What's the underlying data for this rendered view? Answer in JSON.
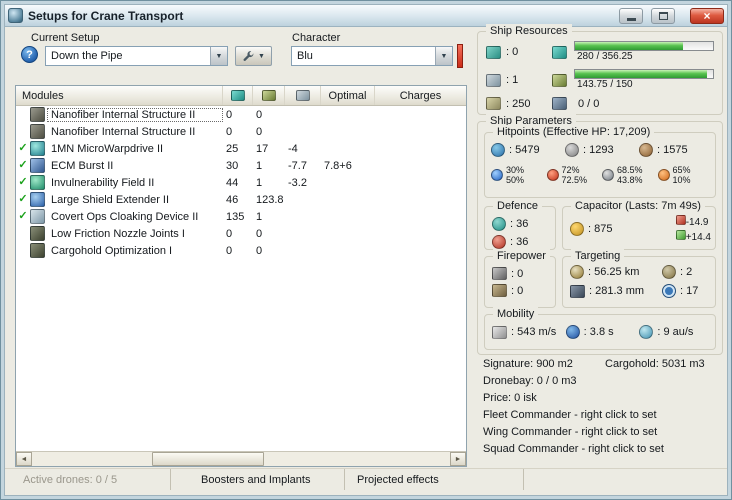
{
  "window": {
    "title": "Setups for Crane Transport"
  },
  "icons": {
    "help": "?",
    "chevron_down": "▼",
    "scroll_left": "◄",
    "scroll_right": "►",
    "close": "×"
  },
  "toolbar": {
    "current_setup_label": "Current Setup",
    "current_setup_value": "Down the Pipe",
    "character_label": "Character",
    "character_value": "Blu"
  },
  "modules": {
    "header": {
      "title": "Modules",
      "optimal": "Optimal",
      "charges": "Charges"
    },
    "rows": [
      {
        "check": "",
        "name": "Nanofiber Internal Structure II",
        "cpu": "0",
        "pg": "0",
        "cap": "",
        "optimal": "",
        "charges": ""
      },
      {
        "check": "",
        "name": "Nanofiber Internal Structure II",
        "cpu": "0",
        "pg": "0",
        "cap": "",
        "optimal": "",
        "charges": ""
      },
      {
        "check": "✓",
        "name": "1MN MicroWarpdrive II",
        "cpu": "25",
        "pg": "17",
        "cap": "-4",
        "optimal": "",
        "charges": ""
      },
      {
        "check": "✓",
        "name": "ECM Burst II",
        "cpu": "30",
        "pg": "1",
        "cap": "-7.7",
        "optimal": "7.8+6",
        "charges": ""
      },
      {
        "check": "✓",
        "name": "Invulnerability Field II",
        "cpu": "44",
        "pg": "1",
        "cap": "-3.2",
        "optimal": "",
        "charges": ""
      },
      {
        "check": "✓",
        "name": "Large Shield Extender II",
        "cpu": "46",
        "pg": "123.8",
        "cap": "",
        "optimal": "",
        "charges": ""
      },
      {
        "check": "✓",
        "name": "Covert Ops Cloaking Device II",
        "cpu": "135",
        "pg": "1",
        "cap": "",
        "optimal": "",
        "charges": ""
      },
      {
        "check": "",
        "name": "Low Friction Nozzle Joints I",
        "cpu": "0",
        "pg": "0",
        "cap": "",
        "optimal": "",
        "charges": ""
      },
      {
        "check": "",
        "name": "Cargohold Optimization I",
        "cpu": "0",
        "pg": "0",
        "cap": "",
        "optimal": "",
        "charges": ""
      }
    ]
  },
  "bottom_tabs": {
    "active_drones": "Active drones: 0 / 5",
    "boosters": "Boosters and Implants",
    "projected": "Projected effects"
  },
  "ship_resources": {
    "title": "Ship Resources",
    "turret_hardpoints": ": 0",
    "launcher_hardpoints": ": 1",
    "calibration": ": 250",
    "cpu": {
      "text": "280 / 356.25",
      "pct": 78.6
    },
    "powergrid": {
      "text": "143.75 / 150",
      "pct": 95.8
    },
    "dronebay": "0 / 0"
  },
  "ship_parameters": {
    "title": "Ship Parameters",
    "hitpoints": {
      "title": "Hitpoints (Effective HP: 17,209)",
      "shield": ": 5479",
      "armor": ": 1293",
      "structure": ": 1575",
      "resists": {
        "em": {
          "top": "30%",
          "bottom": "50%"
        },
        "thermal": {
          "top": "72%",
          "bottom": "72.5%"
        },
        "kinetic": {
          "top": "68.5%",
          "bottom": "43.8%"
        },
        "explosive": {
          "top": "65%",
          "bottom": "10%"
        }
      }
    },
    "defence": {
      "title": "Defence",
      "reinforced": ": 36",
      "sustained": ": 36"
    },
    "capacitor": {
      "title": "Capacitor (Lasts: 7m 49s)",
      "capacity": ": 875",
      "peak_usage": "-14.9",
      "recharge": "+14.4"
    },
    "firepower": {
      "title": "Firepower",
      "turret_dps": ": 0",
      "missile_dps": ": 0"
    },
    "targeting": {
      "title": "Targeting",
      "range": ": 56.25 km",
      "max_targets": ": 2",
      "scan_resolution": ": 281.3 mm",
      "sensor_strength": ": 17"
    },
    "mobility": {
      "title": "Mobility",
      "max_velocity": ": 543 m/s",
      "align_time": ": 3.8 s",
      "warp_speed": ": 9 au/s"
    }
  },
  "stats": {
    "signature": "Signature: 900 m2",
    "cargohold": "Cargohold: 5031 m3",
    "dronebay": "Dronebay: 0 / 0 m3",
    "price": "Price: 0 isk",
    "fleet_commander": "Fleet Commander - right click to set",
    "wing_commander": "Wing Commander - right click to set",
    "squad_commander": "Squad Commander - right click to set"
  },
  "colors": {
    "progress_green": "#3cb43c",
    "close_red": "#bc3520",
    "indicator_red": "#cb2c18"
  }
}
